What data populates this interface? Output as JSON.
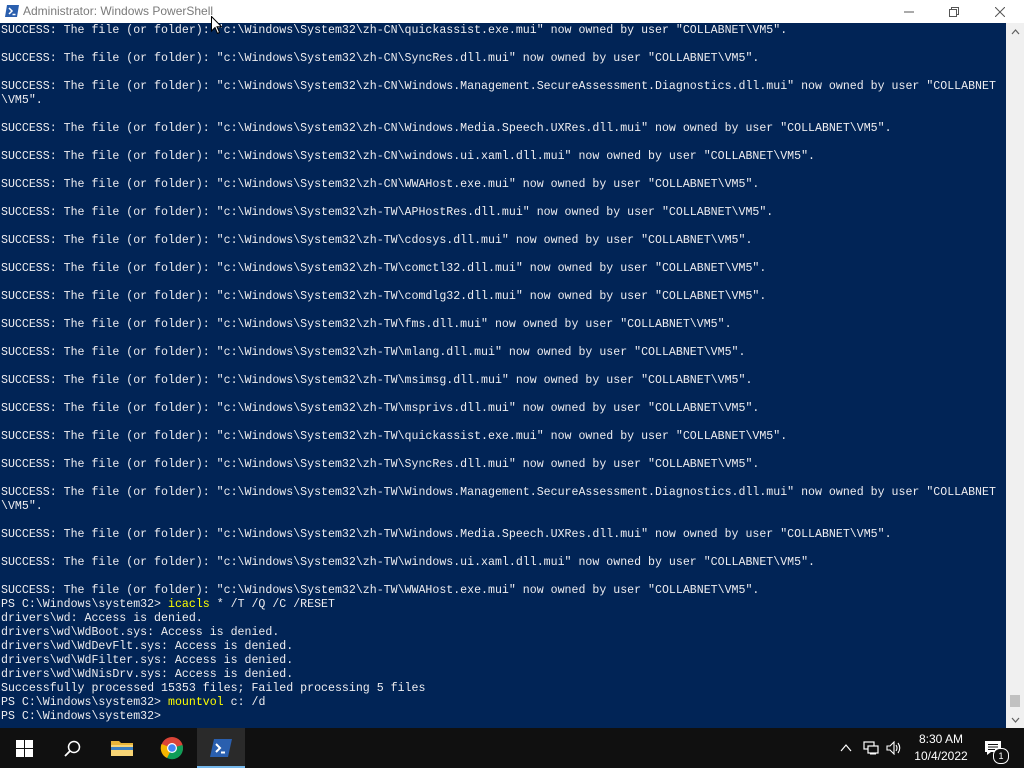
{
  "window": {
    "title": "Administrator: Windows PowerShell"
  },
  "console": {
    "lines": [
      {
        "text": "SUCCESS: The file (or folder): \"c:\\Windows\\System32\\zh-CN\\quickassist.exe.mui\" now owned by user \"COLLABNET\\VM5\"."
      },
      {
        "text": ""
      },
      {
        "text": "SUCCESS: The file (or folder): \"c:\\Windows\\System32\\zh-CN\\SyncRes.dll.mui\" now owned by user \"COLLABNET\\VM5\"."
      },
      {
        "text": ""
      },
      {
        "text": "SUCCESS: The file (or folder): \"c:\\Windows\\System32\\zh-CN\\Windows.Management.SecureAssessment.Diagnostics.dll.mui\" now owned by user \"COLLABNET"
      },
      {
        "text": "\\VM5\"."
      },
      {
        "text": ""
      },
      {
        "text": "SUCCESS: The file (or folder): \"c:\\Windows\\System32\\zh-CN\\Windows.Media.Speech.UXRes.dll.mui\" now owned by user \"COLLABNET\\VM5\"."
      },
      {
        "text": ""
      },
      {
        "text": "SUCCESS: The file (or folder): \"c:\\Windows\\System32\\zh-CN\\windows.ui.xaml.dll.mui\" now owned by user \"COLLABNET\\VM5\"."
      },
      {
        "text": ""
      },
      {
        "text": "SUCCESS: The file (or folder): \"c:\\Windows\\System32\\zh-CN\\WWAHost.exe.mui\" now owned by user \"COLLABNET\\VM5\"."
      },
      {
        "text": ""
      },
      {
        "text": "SUCCESS: The file (or folder): \"c:\\Windows\\System32\\zh-TW\\APHostRes.dll.mui\" now owned by user \"COLLABNET\\VM5\"."
      },
      {
        "text": ""
      },
      {
        "text": "SUCCESS: The file (or folder): \"c:\\Windows\\System32\\zh-TW\\cdosys.dll.mui\" now owned by user \"COLLABNET\\VM5\"."
      },
      {
        "text": ""
      },
      {
        "text": "SUCCESS: The file (or folder): \"c:\\Windows\\System32\\zh-TW\\comctl32.dll.mui\" now owned by user \"COLLABNET\\VM5\"."
      },
      {
        "text": ""
      },
      {
        "text": "SUCCESS: The file (or folder): \"c:\\Windows\\System32\\zh-TW\\comdlg32.dll.mui\" now owned by user \"COLLABNET\\VM5\"."
      },
      {
        "text": ""
      },
      {
        "text": "SUCCESS: The file (or folder): \"c:\\Windows\\System32\\zh-TW\\fms.dll.mui\" now owned by user \"COLLABNET\\VM5\"."
      },
      {
        "text": ""
      },
      {
        "text": "SUCCESS: The file (or folder): \"c:\\Windows\\System32\\zh-TW\\mlang.dll.mui\" now owned by user \"COLLABNET\\VM5\"."
      },
      {
        "text": ""
      },
      {
        "text": "SUCCESS: The file (or folder): \"c:\\Windows\\System32\\zh-TW\\msimsg.dll.mui\" now owned by user \"COLLABNET\\VM5\"."
      },
      {
        "text": ""
      },
      {
        "text": "SUCCESS: The file (or folder): \"c:\\Windows\\System32\\zh-TW\\msprivs.dll.mui\" now owned by user \"COLLABNET\\VM5\"."
      },
      {
        "text": ""
      },
      {
        "text": "SUCCESS: The file (or folder): \"c:\\Windows\\System32\\zh-TW\\quickassist.exe.mui\" now owned by user \"COLLABNET\\VM5\"."
      },
      {
        "text": ""
      },
      {
        "text": "SUCCESS: The file (or folder): \"c:\\Windows\\System32\\zh-TW\\SyncRes.dll.mui\" now owned by user \"COLLABNET\\VM5\"."
      },
      {
        "text": ""
      },
      {
        "text": "SUCCESS: The file (or folder): \"c:\\Windows\\System32\\zh-TW\\Windows.Management.SecureAssessment.Diagnostics.dll.mui\" now owned by user \"COLLABNET"
      },
      {
        "text": "\\VM5\"."
      },
      {
        "text": ""
      },
      {
        "text": "SUCCESS: The file (or folder): \"c:\\Windows\\System32\\zh-TW\\Windows.Media.Speech.UXRes.dll.mui\" now owned by user \"COLLABNET\\VM5\"."
      },
      {
        "text": ""
      },
      {
        "text": "SUCCESS: The file (or folder): \"c:\\Windows\\System32\\zh-TW\\windows.ui.xaml.dll.mui\" now owned by user \"COLLABNET\\VM5\"."
      },
      {
        "text": ""
      },
      {
        "text": "SUCCESS: The file (or folder): \"c:\\Windows\\System32\\zh-TW\\WWAHost.exe.mui\" now owned by user \"COLLABNET\\VM5\"."
      },
      {
        "prompt": "PS C:\\Windows\\system32> ",
        "command": "icacls",
        "args": " * /T /Q /C /RESET"
      },
      {
        "text": "drivers\\wd: Access is denied."
      },
      {
        "text": "drivers\\wd\\WdBoot.sys: Access is denied."
      },
      {
        "text": "drivers\\wd\\WdDevFlt.sys: Access is denied."
      },
      {
        "text": "drivers\\wd\\WdFilter.sys: Access is denied."
      },
      {
        "text": "drivers\\wd\\WdNisDrv.sys: Access is denied."
      },
      {
        "text": "Successfully processed 15353 files; Failed processing 5 files"
      },
      {
        "prompt": "PS C:\\Windows\\system32> ",
        "command": "mountvol",
        "args": " c: /d"
      },
      {
        "prompt": "PS C:\\Windows\\system32> ",
        "command": "",
        "args": ""
      }
    ],
    "colors": {
      "background": "#012456",
      "text": "#eeedf0",
      "command": "#ffff00"
    }
  },
  "taskbar": {
    "apps": [
      {
        "name": "start-button",
        "icon": "windows-logo-icon"
      },
      {
        "name": "search-button",
        "icon": "search-icon"
      },
      {
        "name": "file-explorer",
        "icon": "folder-icon"
      },
      {
        "name": "chrome",
        "icon": "chrome-icon"
      },
      {
        "name": "powershell",
        "icon": "powershell-icon",
        "active": true
      }
    ],
    "tray": {
      "time": "8:30 AM",
      "date": "10/4/2022",
      "notification_count": "1"
    },
    "accent": "#76b9ed"
  }
}
